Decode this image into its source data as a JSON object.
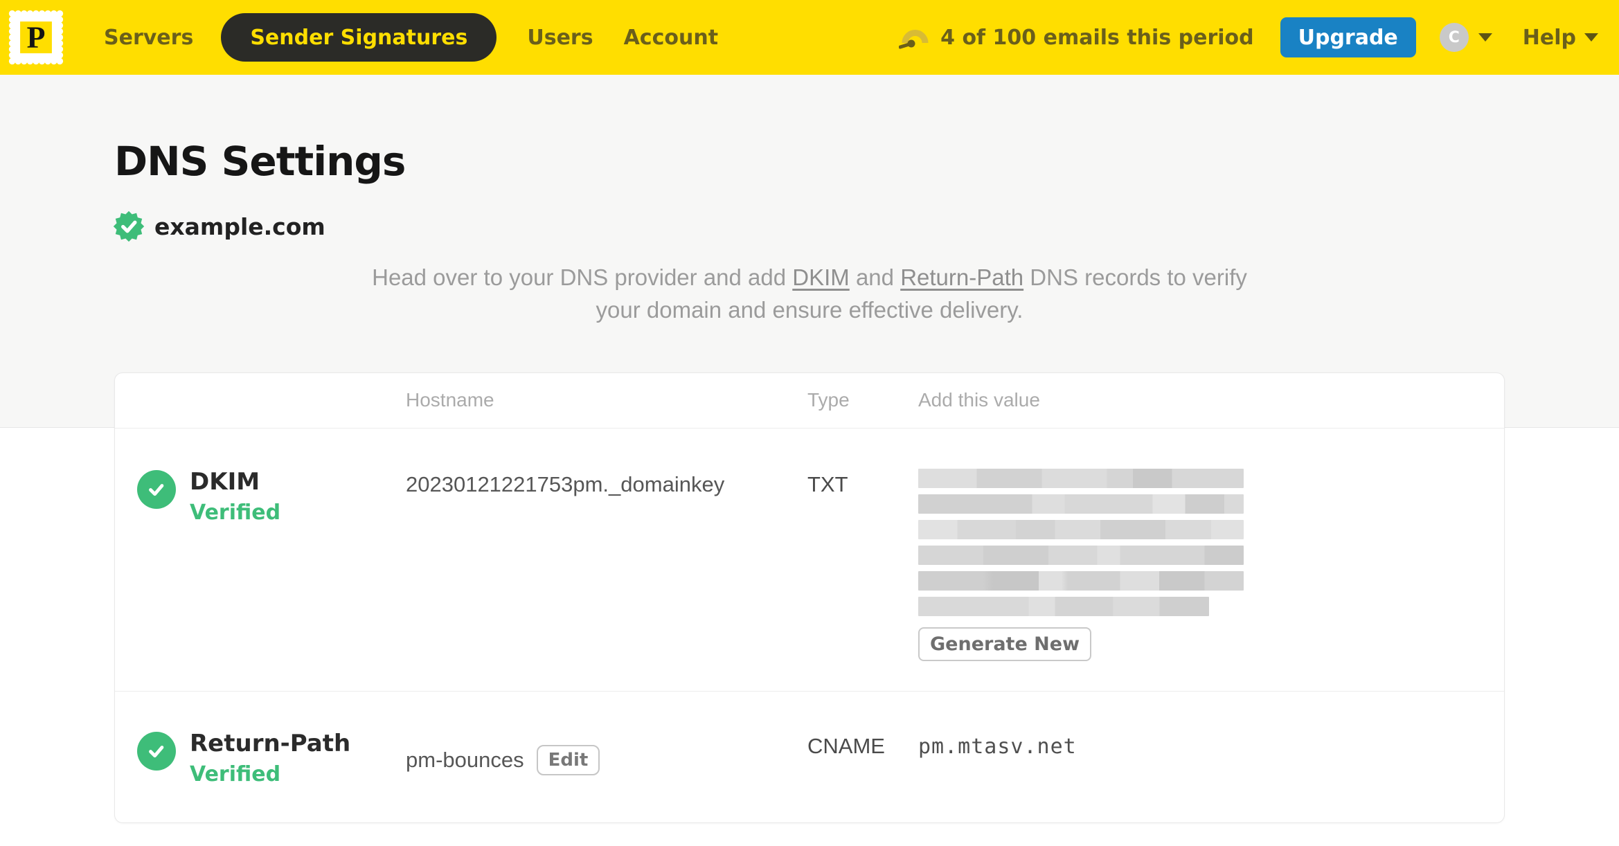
{
  "nav": {
    "logo_letter": "P",
    "items": [
      {
        "label": "Servers",
        "active": false
      },
      {
        "label": "Sender Signatures",
        "active": true
      },
      {
        "label": "Users",
        "active": false
      },
      {
        "label": "Account",
        "active": false
      }
    ],
    "usage_text": "4 of 100 emails this period",
    "upgrade_label": "Upgrade",
    "avatar_initial": "C",
    "help_label": "Help"
  },
  "page": {
    "title": "DNS Settings",
    "domain": "example.com",
    "description": {
      "part1": "Head over to your DNS provider and add ",
      "link_dkim": "DKIM",
      "conjunction": " and ",
      "link_return_path": "Return-Path",
      "part2": " DNS records to verify your domain and ensure effective delivery."
    }
  },
  "table": {
    "headers": {
      "hostname": "Hostname",
      "type": "Type",
      "value": "Add this value"
    },
    "rows": [
      {
        "name": "DKIM",
        "status": "Verified",
        "hostname": "20230121221753pm._domainkey",
        "type": "TXT",
        "value_redacted": true,
        "action_label": "Generate New"
      },
      {
        "name": "Return-Path",
        "status": "Verified",
        "hostname": "pm-bounces",
        "edit_label": "Edit",
        "type": "CNAME",
        "value": "pm.mtasv.net"
      }
    ]
  },
  "colors": {
    "brand_yellow": "#FFDE00",
    "nav_text": "#6A5F1B",
    "active_pill": "#2B2B27",
    "upgrade_blue": "#1982C4",
    "verified_green": "#3EBD79"
  }
}
